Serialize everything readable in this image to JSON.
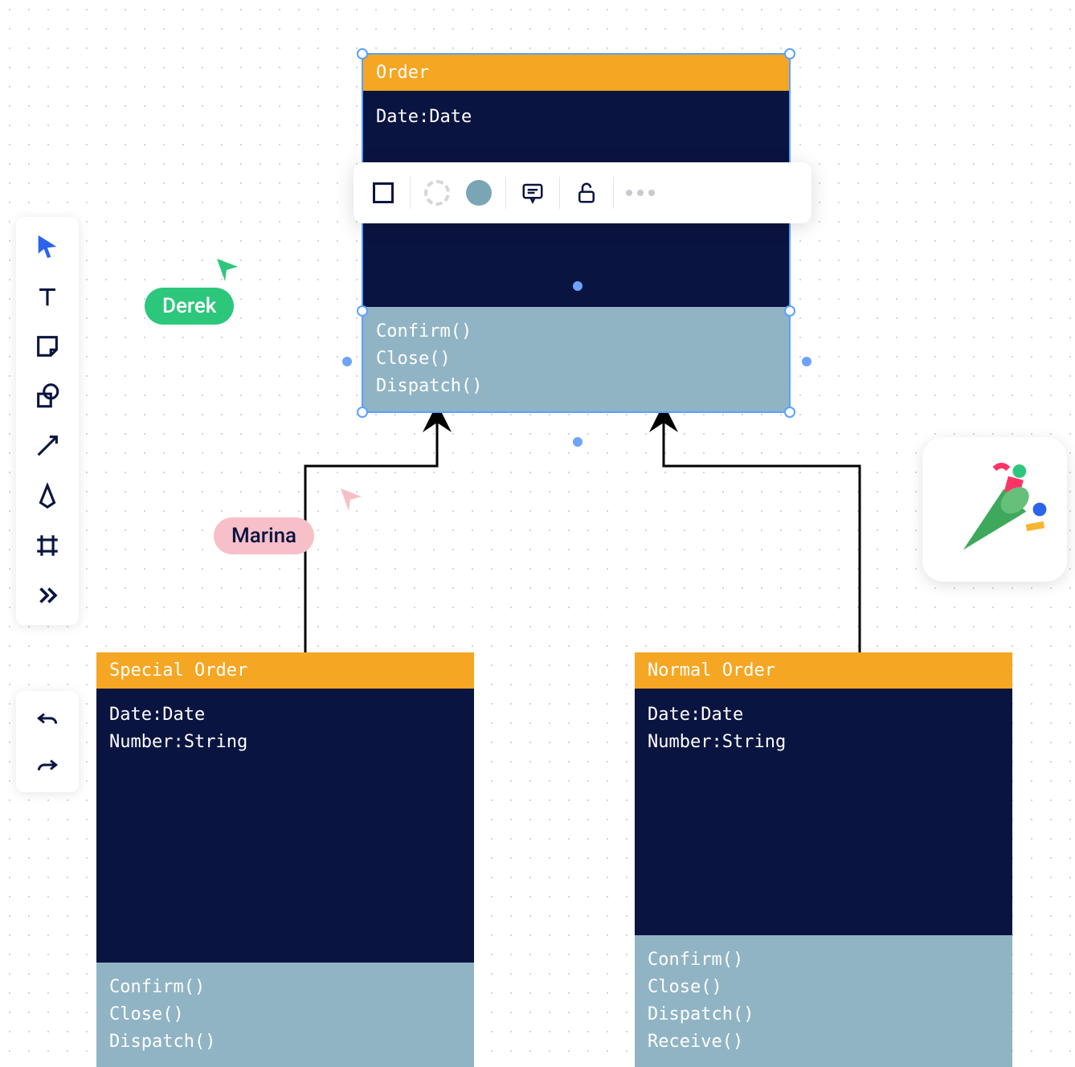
{
  "cursors": {
    "derek": {
      "label": "Derek"
    },
    "marina": {
      "label": "Marina"
    }
  },
  "uml": {
    "order": {
      "title": "Order",
      "attr1": "Date:Date",
      "method1": "Confirm()",
      "method2": "Close()",
      "method3": "Dispatch()"
    },
    "special": {
      "title": "Special Order",
      "attr1": "Date:Date",
      "attr2": "Number:String",
      "method1": "Confirm()",
      "method2": "Close()",
      "method3": "Dispatch()"
    },
    "normal": {
      "title": "Normal Order",
      "attr1": "Date:Date",
      "attr2": "Number:String",
      "method1": "Confirm()",
      "method2": "Close()",
      "method3": "Dispatch()",
      "method4": "Receive()"
    }
  },
  "colors": {
    "header": "#f5a623",
    "attrs_bg": "#0a1440",
    "methods_bg": "#90b4c4",
    "selection": "#5aa1ff",
    "derek": "#2dc77c",
    "marina": "#f7bfc8"
  }
}
